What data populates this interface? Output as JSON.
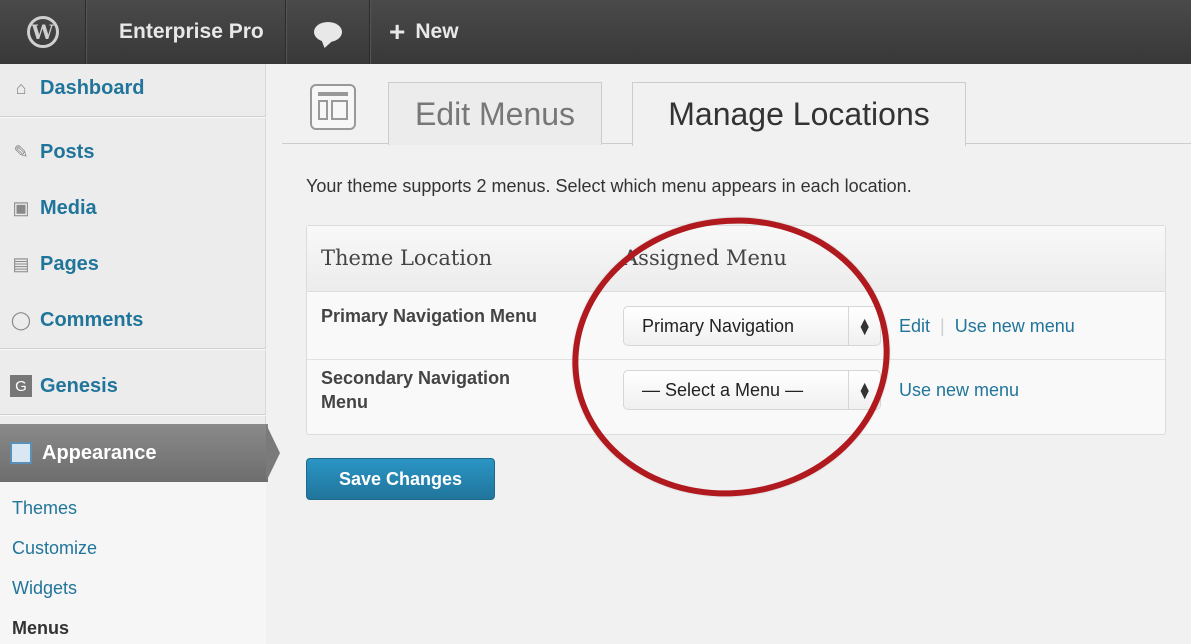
{
  "adminbar": {
    "wp_logo_icon": "wordpress-logo-icon",
    "site_name": "Enterprise Pro",
    "comments_icon": "comment-bubble-icon",
    "new_label": "New",
    "new_icon": "plus-icon"
  },
  "sidebar": {
    "items": [
      {
        "label": "Dashboard",
        "icon": "house-icon"
      },
      {
        "label": "Posts",
        "icon": "pushpin-icon"
      },
      {
        "label": "Media",
        "icon": "camera-icon"
      },
      {
        "label": "Pages",
        "icon": "page-icon"
      },
      {
        "label": "Comments",
        "icon": "speech-bubble-icon"
      },
      {
        "label": "Genesis",
        "icon": "genesis-icon",
        "icon_text": "G"
      },
      {
        "label": "Appearance",
        "icon": "appearance-icon",
        "current": true
      }
    ],
    "submenu": [
      "Themes",
      "Customize",
      "Widgets",
      "Menus"
    ],
    "submenu_current": "Menus"
  },
  "main": {
    "tabs": [
      {
        "label": "Edit Menus",
        "active": false
      },
      {
        "label": "Manage Locations",
        "active": true
      }
    ],
    "description": "Your theme supports 2 menus. Select which menu appears in each location.",
    "table": {
      "headers": [
        "Theme Location",
        "Assigned Menu"
      ],
      "rows": [
        {
          "location_lines": [
            "Primary Navigation Menu"
          ],
          "selected": "Primary Navigation",
          "links": [
            "Edit",
            "Use new menu"
          ]
        },
        {
          "location_lines": [
            "Secondary Navigation",
            "Menu"
          ],
          "selected": "— Select a Menu —",
          "links": [
            "Use new menu"
          ]
        }
      ]
    },
    "save_label": "Save Changes"
  },
  "colors": {
    "link": "#21759b",
    "adminbar": "#404040",
    "primary_button": "#2a95c5",
    "annotation": "#b0191e"
  }
}
